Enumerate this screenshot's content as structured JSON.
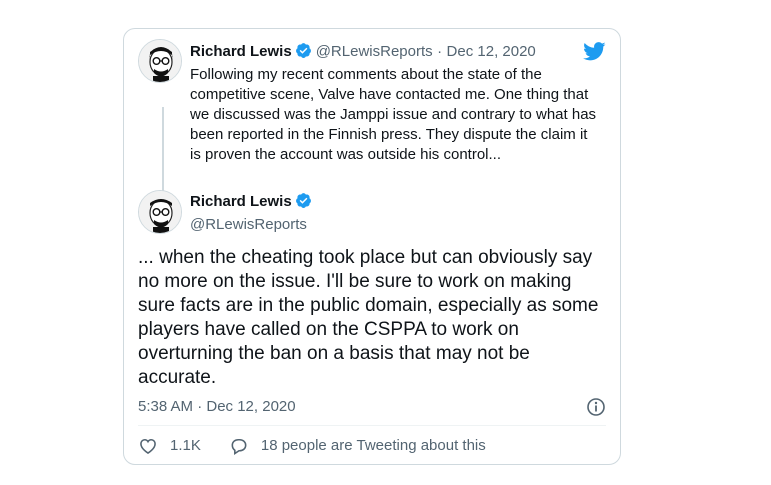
{
  "quoted_tweet": {
    "author_name": "Richard Lewis",
    "handle": "@RLewisReports",
    "separator": "·",
    "date": "Dec 12, 2020",
    "text": "Following my recent comments about the state of the competitive scene, Valve have contacted me. One thing that we discussed was the Jamppi issue and contrary to what has been reported in the Finnish press. They dispute the claim it is proven the account was outside his control...",
    "icon": "twitter-bird-icon"
  },
  "main_tweet": {
    "author_name": "Richard Lewis",
    "handle": "@RLewisReports",
    "text": "... when the cheating took place but can obviously say no more on the issue. I'll be sure to work on making sure facts are in the public domain, especially as some players have called on the CSPPA to work on overturning the ban on a basis that may not be accurate.",
    "timestamp": "5:38 AM · Dec 12, 2020"
  },
  "actions": {
    "likes": "1.1K",
    "replies_text": "18 people are Tweeting about this"
  },
  "colors": {
    "brand_blue": "#1d9bf0",
    "text_primary": "#0f1419",
    "text_secondary": "#536471",
    "border": "#cfd9de"
  }
}
